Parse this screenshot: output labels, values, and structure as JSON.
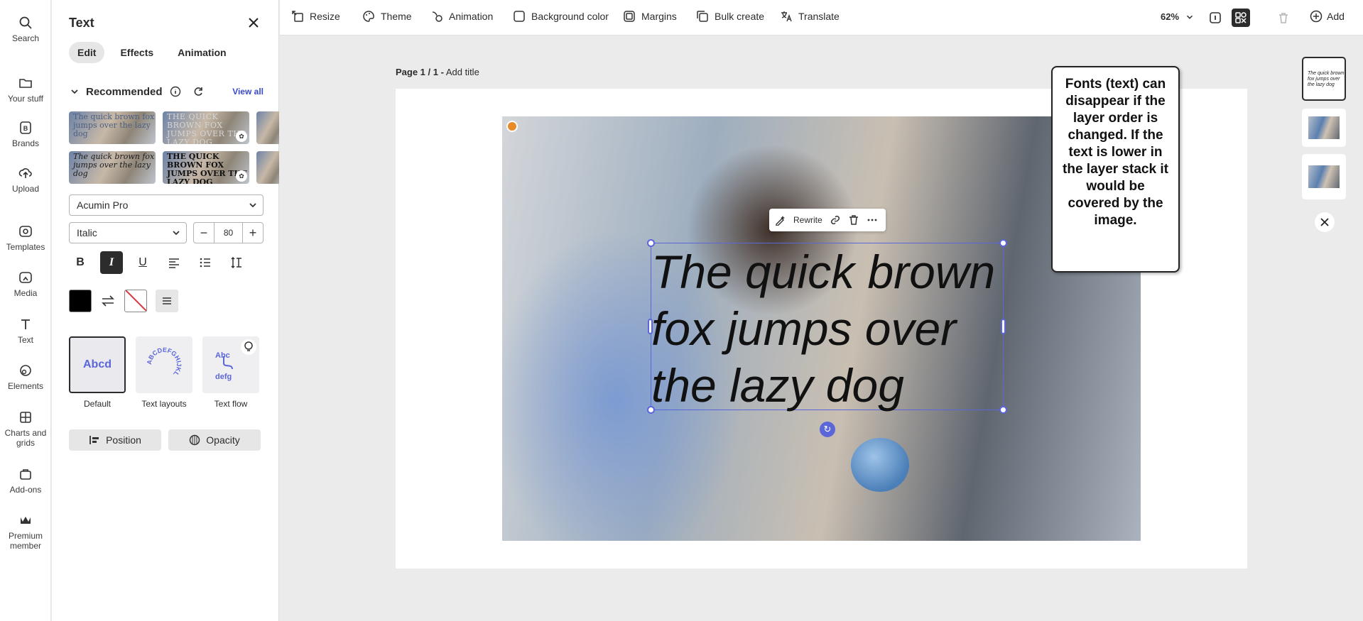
{
  "rail": [
    {
      "label": "Search",
      "icon": "search-icon"
    },
    {
      "label": "Your stuff",
      "icon": "folder-icon"
    },
    {
      "label": "Brands",
      "icon": "brand-icon"
    },
    {
      "label": "Upload",
      "icon": "upload-icon"
    },
    {
      "label": "Templates",
      "icon": "templates-icon"
    },
    {
      "label": "Media",
      "icon": "media-icon"
    },
    {
      "label": "Text",
      "icon": "text-icon"
    },
    {
      "label": "Elements",
      "icon": "elements-icon"
    },
    {
      "label": "Charts and grids",
      "icon": "charts-icon"
    },
    {
      "label": "Add-ons",
      "icon": "addons-icon"
    },
    {
      "label": "Premium member",
      "icon": "crown-icon"
    }
  ],
  "panel": {
    "title": "Text",
    "tabs": [
      "Edit",
      "Effects",
      "Animation"
    ],
    "active_tab": "Edit",
    "recommended": {
      "label": "Recommended",
      "view_all": "View all"
    },
    "thumbs": [
      "The quick brown fox jumps over the lazy dog",
      "THE QUICK BROWN FOX JUMPS OVER THE LAZY DOG",
      "The quick brown fox jumps over the lazy dog",
      "THE QUICK BROWN FOX JUMPS OVER THE LAZY DOG"
    ],
    "font_family": "Acumin Pro",
    "font_style": "Italic",
    "font_size": "80",
    "text_color": "#000000",
    "presets": [
      {
        "label": "Default",
        "sample": "Abcd"
      },
      {
        "label": "Text layouts",
        "sample": "ABCDEFGHIJKL"
      },
      {
        "label": "Text flow",
        "sample": "Abc defg"
      }
    ],
    "position_label": "Position",
    "opacity_label": "Opacity"
  },
  "toolbar": {
    "resize": "Resize",
    "theme": "Theme",
    "animation": "Animation",
    "background_color": "Background color",
    "margins": "Margins",
    "bulk_create": "Bulk create",
    "translate": "Translate",
    "zoom": "62%",
    "add": "Add"
  },
  "canvas": {
    "page_number": "Page 1 / 1 -",
    "add_title": "Add title",
    "text_lines": [
      "The quick brown",
      "fox jumps over",
      "the lazy dog"
    ],
    "context_menu": {
      "rewrite": "Rewrite"
    },
    "callout": "Fonts (text) can disappear if the layer order is changed.  If the text is lower in the layer stack it would be covered by the image.",
    "mini_text": "The quick brown fox jumps over the lazy dog"
  },
  "colors": {
    "accent": "#5b66d9",
    "link": "#3a49c8"
  }
}
